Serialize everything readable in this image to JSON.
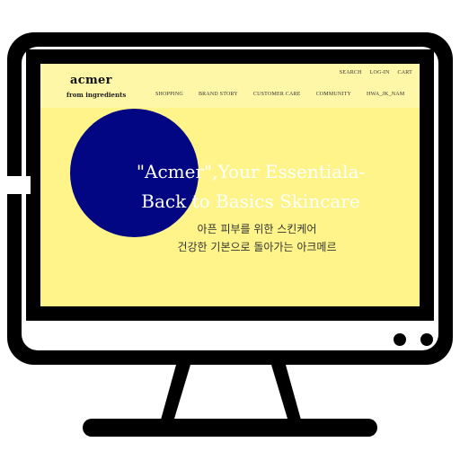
{
  "site": {
    "logo": "acmer",
    "tagline": "from ingredients"
  },
  "util_nav": {
    "search": "SEARCH",
    "login": "LOG-IN",
    "cart": "CART"
  },
  "main_nav": {
    "items": [
      {
        "label": "SHOPPING"
      },
      {
        "label": "BRAND STORY"
      },
      {
        "label": "CUSTOMER CARE"
      },
      {
        "label": "COMMUNITY"
      },
      {
        "label": "HWA_JK_NAM"
      }
    ]
  },
  "hero": {
    "title_line1": "\"Acmer\",Your Essentiala-",
    "title_line2": "Back to Basics Skincare",
    "subtitle_line1": "아픈 피부를 위한 스킨케어",
    "subtitle_line2": "건강한 기본으로 돌아가는 아크메르"
  },
  "colors": {
    "screen_background": "#fef48a",
    "header_background": "#fef7a8",
    "hero_circle": "#030683",
    "monitor_outline": "#000000"
  },
  "icons": {
    "monitor": "desktop-monitor-icon",
    "power_buttons": "monitor-button-icon"
  }
}
